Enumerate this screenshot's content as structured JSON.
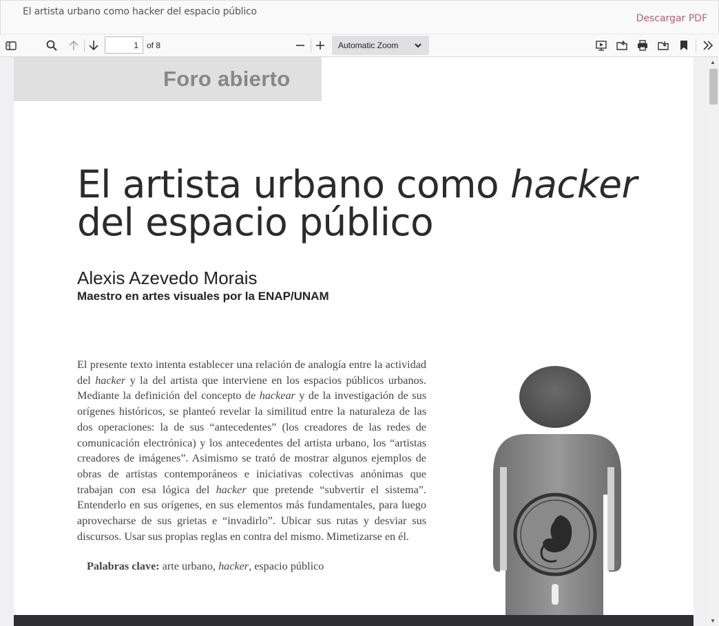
{
  "header": {
    "doc_title": "El artista urbano como hacker del espacio público",
    "download_label": "Descargar PDF"
  },
  "toolbar": {
    "page_value": "1",
    "page_total": "of 8",
    "zoom_label": "Automatic Zoom",
    "icons": [
      "sidebar-toggle-icon",
      "search-icon",
      "arrow-up-icon",
      "arrow-down-icon",
      "zoom-out-icon",
      "zoom-in-icon",
      "presentation-icon",
      "open-file-icon",
      "print-icon",
      "save-icon",
      "bookmark-icon",
      "tools-chevron-icon"
    ]
  },
  "document": {
    "section_label": "Foro abierto",
    "title_part1": "El artista urbano como ",
    "title_italic": "hacker",
    "title_line2": "del espacio público",
    "author": "Alexis Azevedo Morais",
    "affiliation": "Maestro en artes visuales por la ENAP/UNAM",
    "abstract_1": "El presente texto intenta establecer una relación de analogía entre la actividad del ",
    "abstract_it1": "hacker",
    "abstract_2": " y la del artista que interviene en los espacios públicos urbanos. Mediante la definición del concepto de ",
    "abstract_it2": "hackear",
    "abstract_3": " y de la investigación de sus orígenes históricos, se planteó revelar la similitud entre la naturaleza de las dos operaciones: la de sus “antecedentes” (los creadores de las redes de comunicación electrónica) y los antecedentes del artista urbano, los “artistas creadores de imágenes”. Asimismo se trató de mostrar algunos ejemplos de obras de artistas contemporáneos e iniciativas colectivas anónimas que trabajan con esa lógica del ",
    "abstract_it3": "hacker",
    "abstract_4": " que pretende “subvertir el sistema”. Entenderlo en sus orígenes, en sus elementos más fundamentales, para luego aprovecharse de sus grietas e “invadirlo”. Ubicar sus rutas y desviar sus discursos. Usar sus propias reglas en contra del mismo. Mimetizarse en él.",
    "keywords_label": "Palabras clave:",
    "keywords_1": " arte urbano, ",
    "keywords_it": "hacker",
    "keywords_2": ", espacio público"
  },
  "colors": {
    "accent_link": "#b0607a",
    "toolbar_bg": "#f9f9fa",
    "section_box": "#e0e0e0"
  }
}
